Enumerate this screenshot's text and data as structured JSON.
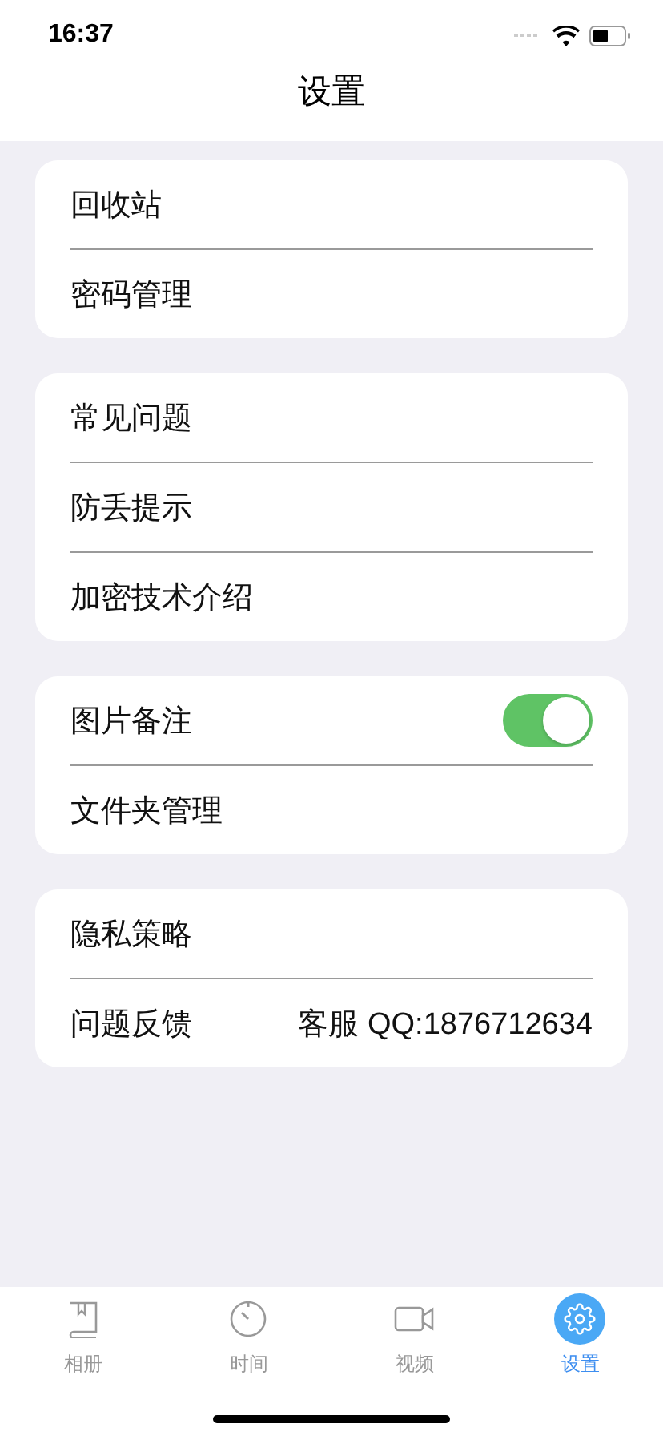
{
  "status_bar": {
    "time": "16:37"
  },
  "header": {
    "title": "设置"
  },
  "groups": [
    {
      "rows": [
        {
          "kind": "plain",
          "label": "回收站"
        },
        {
          "kind": "plain",
          "label": "密码管理"
        }
      ]
    },
    {
      "rows": [
        {
          "kind": "plain",
          "label": "常见问题"
        },
        {
          "kind": "plain",
          "label": "防丢提示"
        },
        {
          "kind": "plain",
          "label": "加密技术介绍"
        }
      ]
    },
    {
      "rows": [
        {
          "kind": "toggle",
          "label": "图片备注",
          "on": true
        },
        {
          "kind": "plain",
          "label": "文件夹管理"
        }
      ]
    },
    {
      "rows": [
        {
          "kind": "plain",
          "label": "隐私策略"
        },
        {
          "kind": "detail",
          "label": "问题反馈",
          "detail": "客服 QQ:1876712634"
        }
      ]
    }
  ],
  "tab_bar": [
    {
      "kind": "album",
      "label": "相册",
      "selected": false
    },
    {
      "kind": "timer",
      "label": "时间",
      "selected": false
    },
    {
      "kind": "video",
      "label": "视频",
      "selected": false
    },
    {
      "kind": "settings",
      "label": "设置",
      "selected": true
    }
  ]
}
